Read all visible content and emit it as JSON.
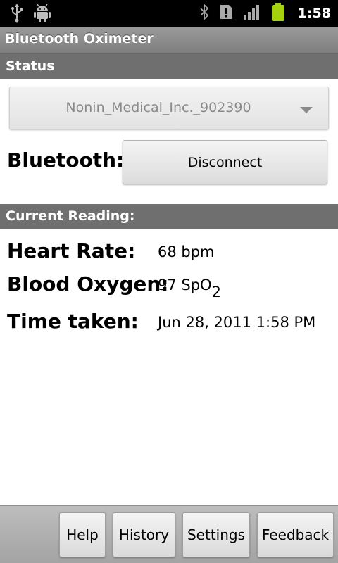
{
  "statusbar": {
    "left_icons": [
      "usb-icon",
      "android-debug-icon"
    ],
    "right_icons": [
      "bluetooth-icon",
      "sim-alert-icon",
      "signal-icon",
      "battery-icon"
    ],
    "time": "1:58",
    "battery_color": "#a4d20c"
  },
  "app": {
    "title": "Bluetooth Oximeter"
  },
  "status_section": {
    "header": "Status",
    "device_spinner_value": "Nonin_Medical_Inc._902390",
    "bluetooth_label": "Bluetooth:",
    "disconnect_label": "Disconnect"
  },
  "reading_section": {
    "header": "Current Reading:",
    "heart_rate_label": "Heart Rate:",
    "heart_rate_value": "68 bpm",
    "blood_oxygen_label": "Blood Oxygen:",
    "blood_oxygen_value": "97 SpO",
    "blood_oxygen_sub": "2",
    "time_label": "Time taken:",
    "time_value": "Jun 28, 2011 1:58 PM"
  },
  "bottom_buttons": {
    "help": "Help",
    "history": "History",
    "settings": "Settings",
    "feedback": "Feedback"
  },
  "colors": {
    "section_header_bg": "#6f6f6f",
    "title_bar_bg": "#8c8c8c"
  }
}
